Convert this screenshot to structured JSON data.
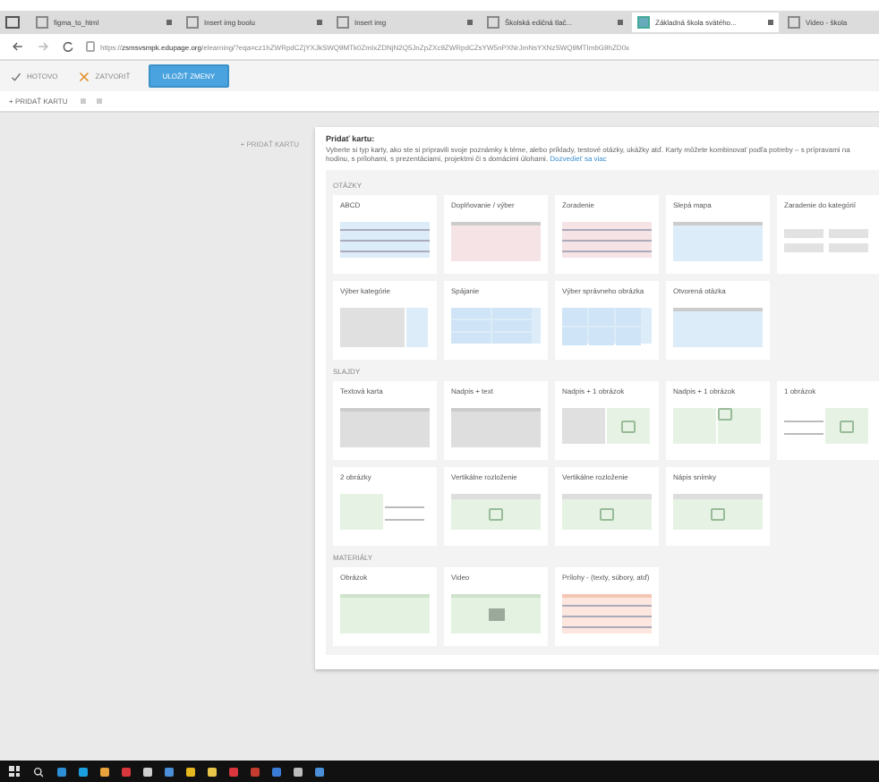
{
  "browser": {
    "tabs": [
      {
        "title": "figma_to_html",
        "selected": false
      },
      {
        "title": "Insert img boolu",
        "selected": false
      },
      {
        "title": "Insert img",
        "selected": false
      },
      {
        "title": "Školská edičná tlač...",
        "selected": false
      },
      {
        "title": "Základná škola svätého...",
        "selected": true
      },
      {
        "title": "Video - škola",
        "selected": false
      }
    ],
    "url_host": "zsmsvsmpk.edupage.org",
    "url_rest": "/elearning/?eqa=cz1hZWRpdCZjYXJkSWQ9MTk0ZmIxZDNjN2Q5JnZpZXc9ZWRpdCZsYW5nPXNrJmNsYXNzSWQ9MTImbG9hZD0x",
    "url_prefix": "https://"
  },
  "toolbar": {
    "done": "HOTOVO",
    "close": "ZATVORIŤ",
    "save": "ULOŽIŤ ZMENY",
    "add_card": "+ PRIDAŤ KARTU"
  },
  "sidebar": {
    "add_card": "+ PRIDAŤ KARTU"
  },
  "panel": {
    "title": "Pridať kartu:",
    "description": "Vyberte si typ karty, ako ste si pripravili svoje poznámky k téme, alebo príklady, testové otázky, ukážky atď. Karty môžete kombinovať podľa potreby – s prípravami na hodinu, s prílohami, s prezentáciami, projektmi či s domácimi úlohami.",
    "link": "Dozvedieť sa viac",
    "sections": [
      {
        "title": "OTÁZKY",
        "cards": [
          {
            "label": "ABCD",
            "kind": "list-blue"
          },
          {
            "label": "Doplňovanie / výber",
            "kind": "pink"
          },
          {
            "label": "Zoradenie",
            "kind": "list-pink"
          },
          {
            "label": "Slepá mapa",
            "kind": "blue"
          },
          {
            "label": "Zaradenie do kategórií",
            "kind": "categories"
          },
          {
            "label": "Výber kategórie",
            "kind": "split-blue"
          },
          {
            "label": "Spájanie",
            "kind": "table"
          },
          {
            "label": "Výber správneho obrázka",
            "kind": "grid"
          },
          {
            "label": "Otvorená otázka",
            "kind": "blue"
          }
        ]
      },
      {
        "title": "SLAJDY",
        "cards": [
          {
            "label": "Textová karta",
            "kind": "gray"
          },
          {
            "label": "Nadpis + text",
            "kind": "gray"
          },
          {
            "label": "Nadpis + 1 obrázok",
            "kind": "image-right"
          },
          {
            "label": "Nadpis + 1 obrázok",
            "kind": "image-left"
          },
          {
            "label": "1 obrázok",
            "kind": "lines-image"
          },
          {
            "label": "2 obrázky",
            "kind": "image-lines"
          },
          {
            "label": "Vertikálne rozloženie",
            "kind": "image-bottom"
          },
          {
            "label": "Vertikálne rozloženie",
            "kind": "image-middle"
          },
          {
            "label": "Nápis snímky",
            "kind": "image-top"
          }
        ]
      },
      {
        "title": "MATERIÁLY",
        "cards": [
          {
            "label": "Obrázok",
            "kind": "green"
          },
          {
            "label": "Video",
            "kind": "video"
          },
          {
            "label": "Prílohy - (texty, súbory, atď)",
            "kind": "orange"
          }
        ]
      }
    ]
  }
}
